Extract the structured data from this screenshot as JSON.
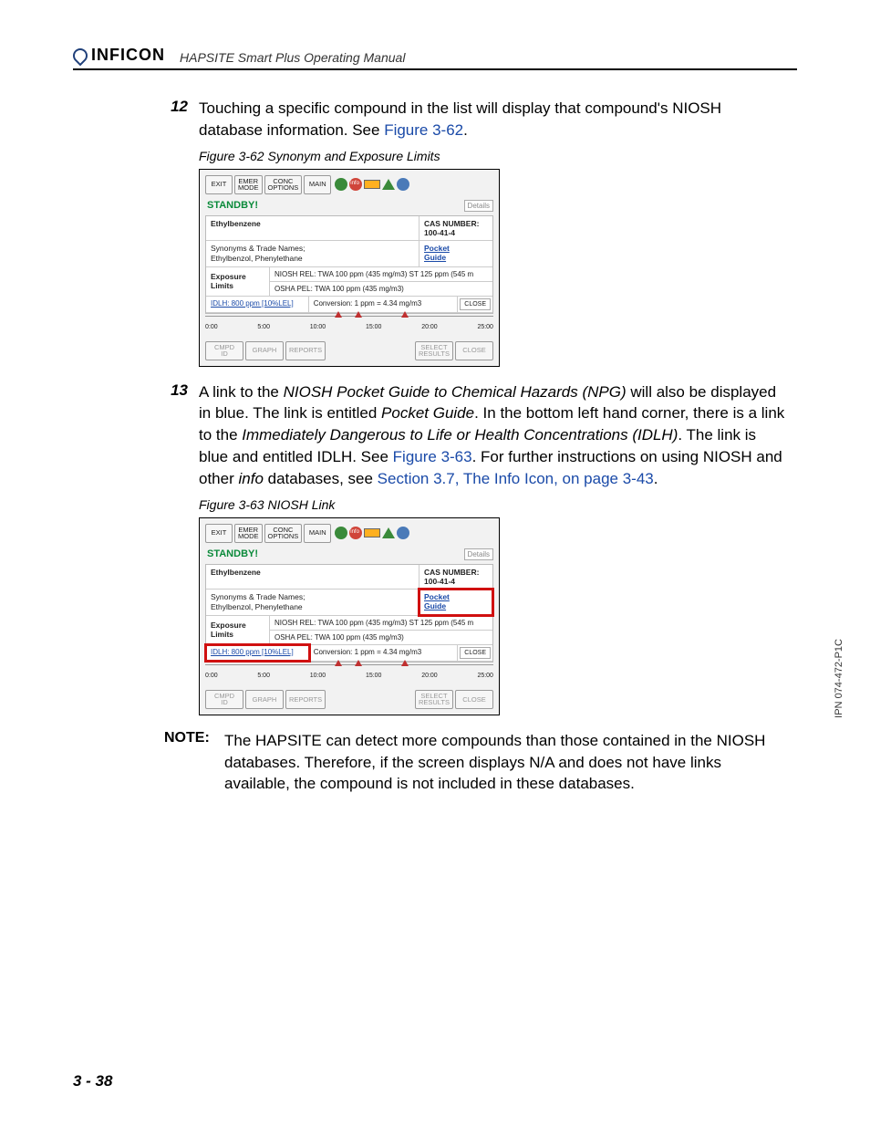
{
  "header": {
    "brand": "INFICON",
    "manual_title": "HAPSITE Smart Plus Operating Manual"
  },
  "step12": {
    "num": "12",
    "text_a": "Touching a specific compound in the list will display that compound's NIOSH database information. See ",
    "link": "Figure 3-62",
    "text_b": "."
  },
  "fig62_caption": "Figure 3-62  Synonym and Exposure Limits",
  "ss": {
    "btn_exit": "EXIT",
    "btn_emer_a": "EMER",
    "btn_emer_b": "MODE",
    "btn_conc_a": "CONC",
    "btn_conc_b": "OPTIONS",
    "btn_main": "MAIN",
    "standby": "STANDBY!",
    "details": "Details",
    "compound": "Ethylbenzene",
    "cas_label": "CAS NUMBER:",
    "cas_value": "100-41-4",
    "syn_label": "Synonyms & Trade Names;",
    "syn_value": "Ethylbenzol, Phenylethane",
    "pocket_a": "Pocket",
    "pocket_b": "Guide",
    "exposure_label_a": "Exposure",
    "exposure_label_b": "Limits",
    "niosh_rel": "NIOSH REL: TWA 100 ppm (435 mg/m3) ST 125 ppm (545 m",
    "osha_pel": "OSHA PEL: TWA 100 ppm (435 mg/m3)",
    "idlh": "IDLH: 800 ppm [10%LEL]",
    "conversion": "Conversion: 1 ppm = 4.34 mg/m3",
    "close_small": "CLOSE",
    "ticks": [
      "0:00",
      "5:00",
      "10:00",
      "15:00",
      "20:00",
      "25:00"
    ],
    "btn_cmpd_a": "CMPD",
    "btn_cmpd_b": "ID",
    "btn_graph": "GRAPH",
    "btn_reports": "REPORTS",
    "btn_select_a": "SELECT",
    "btn_select_b": "RESULTS",
    "btn_close": "CLOSE"
  },
  "step13": {
    "num": "13",
    "t1": "A link to the ",
    "em1": "NIOSH Pocket Guide to Chemical Hazards (NPG)",
    "t2": " will also be displayed in blue. The link is entitled ",
    "em2": "Pocket Guide",
    "t3": ". In the bottom left hand corner, there is a link to the ",
    "em3": "Immediately Dangerous to Life or Health Concentrations (IDLH)",
    "t4": ". The link is blue and entitled IDLH. See ",
    "link1": "Figure 3-63",
    "t5": ". For further instructions on using NIOSH and other ",
    "em4": "info",
    "t6": " databases, see ",
    "link2": "Section 3.7, The Info Icon, on page 3-43",
    "t7": "."
  },
  "fig63_caption": "Figure 3-63  NIOSH Link",
  "note": {
    "label": "NOTE:",
    "body": "The HAPSITE can detect more compounds than those contained in the NIOSH databases. Therefore, if the screen displays N/A and does not have links available, the compound is not included in these databases."
  },
  "page_num": "3 - 38",
  "side_ipn": "IPN 074-472-P1C"
}
